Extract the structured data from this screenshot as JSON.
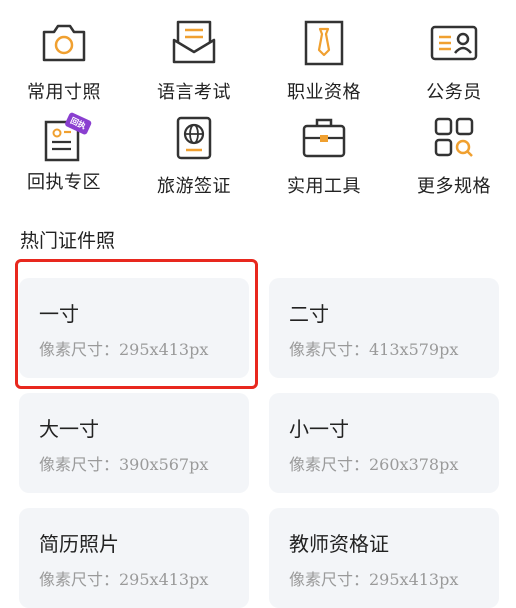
{
  "categories": [
    {
      "label": "常用寸照",
      "icon": "camera-icon"
    },
    {
      "label": "语言考试",
      "icon": "envelope-icon"
    },
    {
      "label": "职业资格",
      "icon": "tie-icon"
    },
    {
      "label": "公务员",
      "icon": "id-card-icon"
    },
    {
      "label": "回执专区",
      "icon": "receipt-icon",
      "badge": "回执"
    },
    {
      "label": "旅游签证",
      "icon": "passport-icon"
    },
    {
      "label": "实用工具",
      "icon": "toolbox-icon"
    },
    {
      "label": "更多规格",
      "icon": "grid-more-icon"
    }
  ],
  "section_title": "热门证件照",
  "cards": [
    {
      "name": "一寸",
      "size": "像素尺寸：295x413px"
    },
    {
      "name": "二寸",
      "size": "像素尺寸：413x579px"
    },
    {
      "name": "大一寸",
      "size": "像素尺寸：390x567px"
    },
    {
      "name": "小一寸",
      "size": "像素尺寸：260x378px"
    },
    {
      "name": "简历照片",
      "size": "像素尺寸：295x413px"
    },
    {
      "name": "教师资格证",
      "size": "像素尺寸：295x413px"
    }
  ],
  "colors": {
    "icon_stroke": "#333333",
    "icon_accent": "#f0a030",
    "badge": "#8a3fd0",
    "card_bg": "#f3f5f8",
    "highlight": "#e8281e"
  }
}
